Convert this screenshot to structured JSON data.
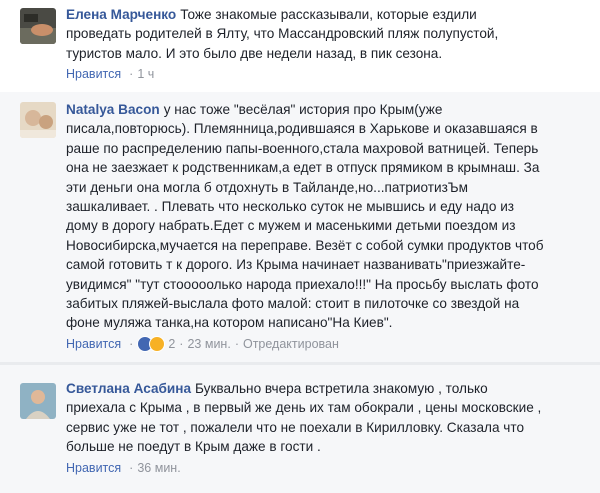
{
  "comments": [
    {
      "author": "Елена Марченко",
      "text": "Тоже знакомые рассказывали, которые ездили\nпроведать родителей в Ялту, что Массандровский пляж полупустой,\nтуристов мало. И это было две недели назад, в пик сезона.",
      "like_label": "Нравится",
      "time": "1 ч"
    },
    {
      "author": "Natalya Bacon",
      "text": "у нас тоже \"весёлая\" история про Крым(уже\nписала,повторюсь). Племянница,родившаяся в Харькове и оказавшаяся в\nраше по распределению папы-военного,стала махровой ватницей. Теперь\nона не заезжает к родственникам,а едет в отпуск прямиком в крымнаш. За\nэти деньги она могла б отдохнуть в Тайланде,но...патриотизЪм\nзашкаливает. . Плевать что несколько суток не мывшись и еду надо из\nдому в дорогу набрать.Едет с мужем и масенькими детьми поездом из\nНовосибирска,мучается на переправе. Везёт с собой сумки продуктов чтоб\nсамой готовить т к дорого. Из Крыма начинает названивать\"приезжайте-\nувидимся\" \"тут стооооолько народа приехало!!!\" На просьбу выслать фото\nзабитых пляжей-выслала фото малой: стоит в пилоточке со звездой на\nфоне муляжа танка,на котором написано\"На Киев\".",
      "like_label": "Нравится",
      "reaction_count": "2",
      "time": "23 мин.",
      "edited": "Отредактирован"
    },
    {
      "author": "Светлана Асабина",
      "text": "Буквально вчера встретила знакомую , только\nприехала с Крыма , в первый же день их там обокрали , цены московские ,\nсервис уже не тот , пожалели что не поехали в Кирилловку. Сказала что\nбольше не поедут в Крым даже в гости .",
      "like_label": "Нравится",
      "time": "36 мин."
    }
  ],
  "separator": "·"
}
